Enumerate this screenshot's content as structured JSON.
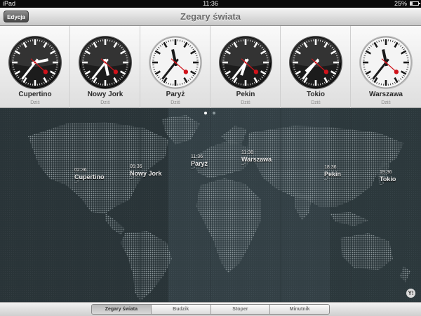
{
  "status_bar": {
    "device": "iPad",
    "time": "11:36",
    "battery": "25%",
    "battery_level": 0.25
  },
  "nav": {
    "title": "Zegary świata",
    "edit_label": "Edycja"
  },
  "clocks": [
    {
      "city": "Cupertino",
      "day": "Dziś",
      "hour": 2,
      "minute": 36,
      "second": 22,
      "dark": true
    },
    {
      "city": "Nowy Jork",
      "day": "Dziś",
      "hour": 5,
      "minute": 36,
      "second": 22,
      "dark": true
    },
    {
      "city": "Paryż",
      "day": "Dziś",
      "hour": 11,
      "minute": 36,
      "second": 22,
      "dark": false
    },
    {
      "city": "Pekin",
      "day": "Dziś",
      "hour": 18,
      "minute": 36,
      "second": 22,
      "dark": true
    },
    {
      "city": "Tokio",
      "day": "Dziś",
      "hour": 19,
      "minute": 36,
      "second": 22,
      "dark": true
    },
    {
      "city": "Warszawa",
      "day": "Dziś",
      "hour": 11,
      "minute": 36,
      "second": 22,
      "dark": false
    }
  ],
  "pager": {
    "pages": 2,
    "current": 0
  },
  "map_pins": [
    {
      "time": "02:36",
      "city": "Cupertino",
      "sub": "--°"
    },
    {
      "time": "05:36",
      "city": "Nowy Jork",
      "sub": "--°"
    },
    {
      "time": "11:36",
      "city": "Paryż",
      "sub": "--°"
    },
    {
      "time": "11:36",
      "city": "Warszawa",
      "sub": "--°"
    },
    {
      "time": "18:36",
      "city": "Pekin",
      "sub": "--°"
    },
    {
      "time": "19:36",
      "city": "Tokio",
      "sub": "--°"
    }
  ],
  "map_logo": "Y!",
  "tabs": [
    {
      "label": "Zegary świata",
      "selected": true
    },
    {
      "label": "Budzik",
      "selected": false
    },
    {
      "label": "Stoper",
      "selected": false
    },
    {
      "label": "Minutnik",
      "selected": false
    }
  ],
  "colors": {
    "map_bg": "#334045",
    "second_hand": "#d0131b"
  }
}
